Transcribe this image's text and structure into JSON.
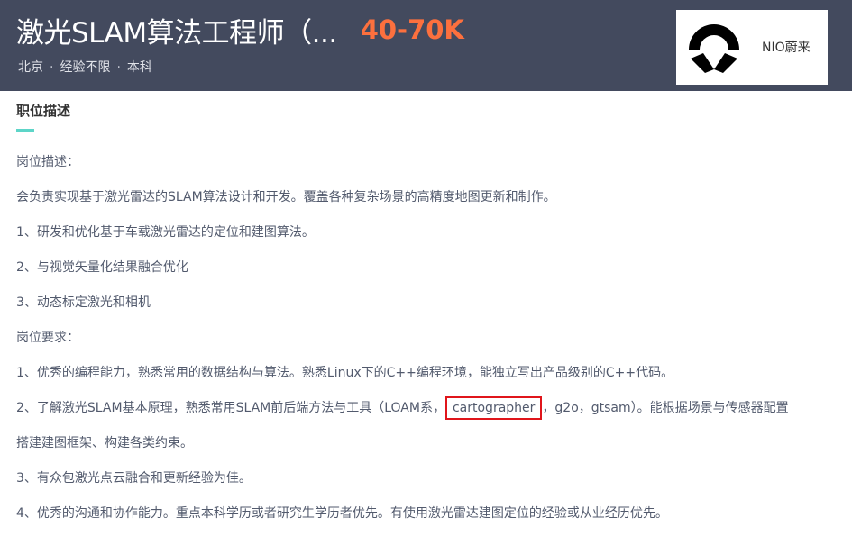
{
  "header": {
    "job_title": "激光SLAM算法工程师（...",
    "salary": "40-70K",
    "city": "北京",
    "experience": "经验不限",
    "education": "本科",
    "separator": "·"
  },
  "company": {
    "name": "NIO蔚来",
    "logo_icon": "nio-logo-icon"
  },
  "section": {
    "title": "职位描述"
  },
  "description": {
    "line1": "岗位描述：",
    "line2": "会负责实现基于激光雷达的SLAM算法设计和开发。覆盖各种复杂场景的高精度地图更新和制作。",
    "line3": "1、研发和优化基于车载激光雷达的定位和建图算法。",
    "line4": "2、与视觉矢量化结果融合优化",
    "line5": "3、动态标定激光和相机",
    "line6": "岗位要求：",
    "line7": "1、优秀的编程能力，熟悉常用的数据结构与算法。熟悉Linux下的C++编程环境，能独立写出产品级别的C++代码。",
    "line8_prefix": "2、了解激光SLAM基本原理，熟悉常用SLAM前后端方法与工具（LOAM系，",
    "line8_highlight": "cartographer",
    "line8_suffix": "，g2o，gtsam）。能根据场景与传感器配置",
    "line9": "搭建建图框架、构建各类约束。",
    "line10": "3、有众包激光点云融合和更新经验为佳。",
    "line11": "4、优秀的沟通和协作能力。重点本科学历或者研究生学历者优先。有使用激光雷达建图定位的经验或从业经历优先。"
  },
  "colors": {
    "header_bg": "#434a5e",
    "salary": "#fc703e",
    "accent_underline": "#5dd5c8",
    "highlight_box": "#e0151b"
  }
}
